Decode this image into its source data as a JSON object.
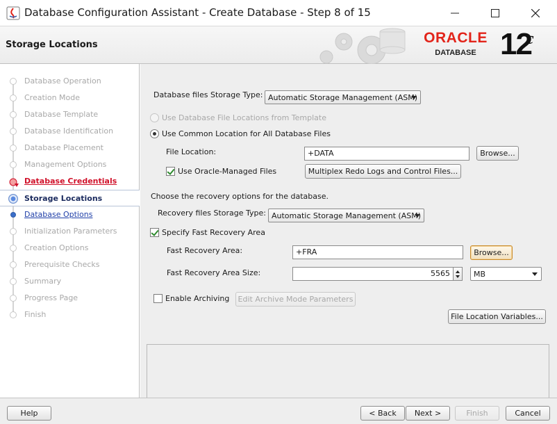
{
  "window": {
    "title": "Database Configuration Assistant - Create Database - Step 8 of 15",
    "controls": [
      "minimize-icon",
      "maximize-icon",
      "close-icon"
    ]
  },
  "header": {
    "page_title": "Storage Locations",
    "brand_word": "ORACLE",
    "brand_sub": "DATABASE",
    "version": "12",
    "version_suffix": "c",
    "brand_color": "#e2241a"
  },
  "nav": {
    "items": [
      {
        "label": "Database Operation",
        "state": "pending"
      },
      {
        "label": "Creation Mode",
        "state": "pending"
      },
      {
        "label": "Database Template",
        "state": "pending"
      },
      {
        "label": "Database Identification",
        "state": "pending"
      },
      {
        "label": "Database Placement",
        "state": "pending"
      },
      {
        "label": "Management Options",
        "state": "pending"
      },
      {
        "label": "Database Credentials",
        "state": "error"
      },
      {
        "label": "Storage Locations",
        "state": "current"
      },
      {
        "label": "Database Options",
        "state": "done"
      },
      {
        "label": "Initialization Parameters",
        "state": "pending"
      },
      {
        "label": "Creation Options",
        "state": "pending"
      },
      {
        "label": "Prerequisite Checks",
        "state": "pending"
      },
      {
        "label": "Summary",
        "state": "pending"
      },
      {
        "label": "Progress Page",
        "state": "pending"
      },
      {
        "label": "Finish",
        "state": "pending"
      }
    ]
  },
  "storage": {
    "type_label": "Database files Storage Type:",
    "type_value": "Automatic Storage Management (ASM)",
    "use_template_label": "Use Database File Locations from Template",
    "use_common_label": "Use Common Location for All Database Files",
    "file_location_label": "File Location:",
    "file_location_value": "+DATA",
    "browse_label": "Browse...",
    "omf_label": "Use Oracle-Managed Files",
    "omf_checked": true,
    "multiplex_label": "Multiplex Redo Logs and Control Files..."
  },
  "recovery": {
    "intro": "Choose the recovery options for the database.",
    "type_label": "Recovery files Storage Type:",
    "type_value": "Automatic Storage Management (ASM)",
    "fra_enable_label": "Specify Fast Recovery Area",
    "fra_enabled": true,
    "fra_label": "Fast Recovery Area:",
    "fra_value": "+FRA",
    "browse_label": "Browse...",
    "fra_size_label": "Fast Recovery Area Size:",
    "fra_size_value": "5565",
    "fra_size_unit": "MB"
  },
  "archiving": {
    "enable_label": "Enable Archiving",
    "enabled": false,
    "edit_params_label": "Edit Archive Mode Parameters",
    "file_loc_vars_label": "File Location Variables..."
  },
  "footer": {
    "help": "Help",
    "back": "< Back",
    "next": "Next >",
    "finish": "Finish",
    "cancel": "Cancel"
  }
}
